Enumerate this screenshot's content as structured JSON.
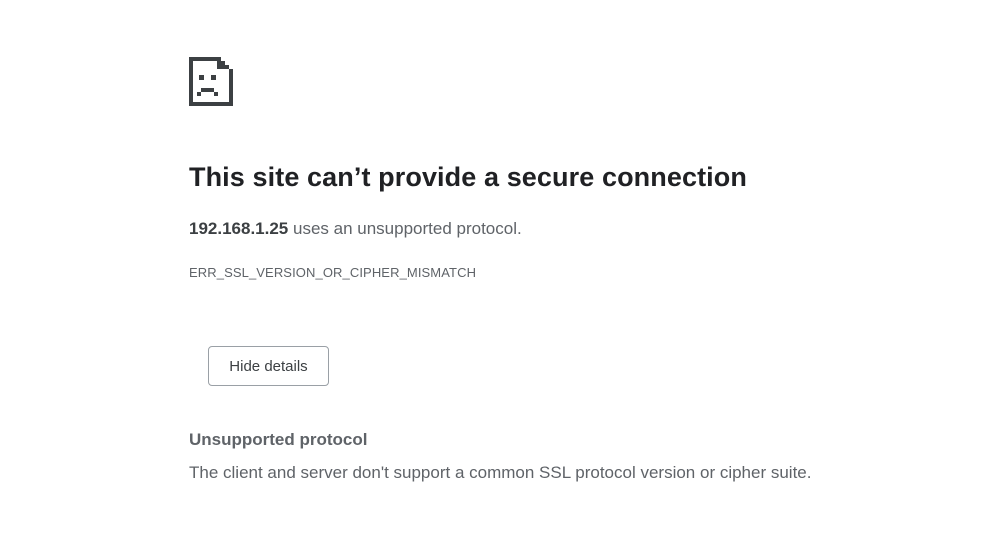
{
  "error_page": {
    "icon": "sad-document-icon",
    "heading": "This site can’t provide a secure connection",
    "summary": {
      "host": "192.168.1.25",
      "message": " uses an unsupported protocol."
    },
    "error_code": "ERR_SSL_VERSION_OR_CIPHER_MISMATCH",
    "details_button_label": "Hide details",
    "details": {
      "title": "Unsupported protocol",
      "body": "The client and server don't support a common SSL protocol version or cipher suite."
    }
  },
  "colors": {
    "heading": "#202124",
    "body_text": "#5f6368",
    "button_border": "#9aa0a6",
    "icon": "#3c4043"
  }
}
